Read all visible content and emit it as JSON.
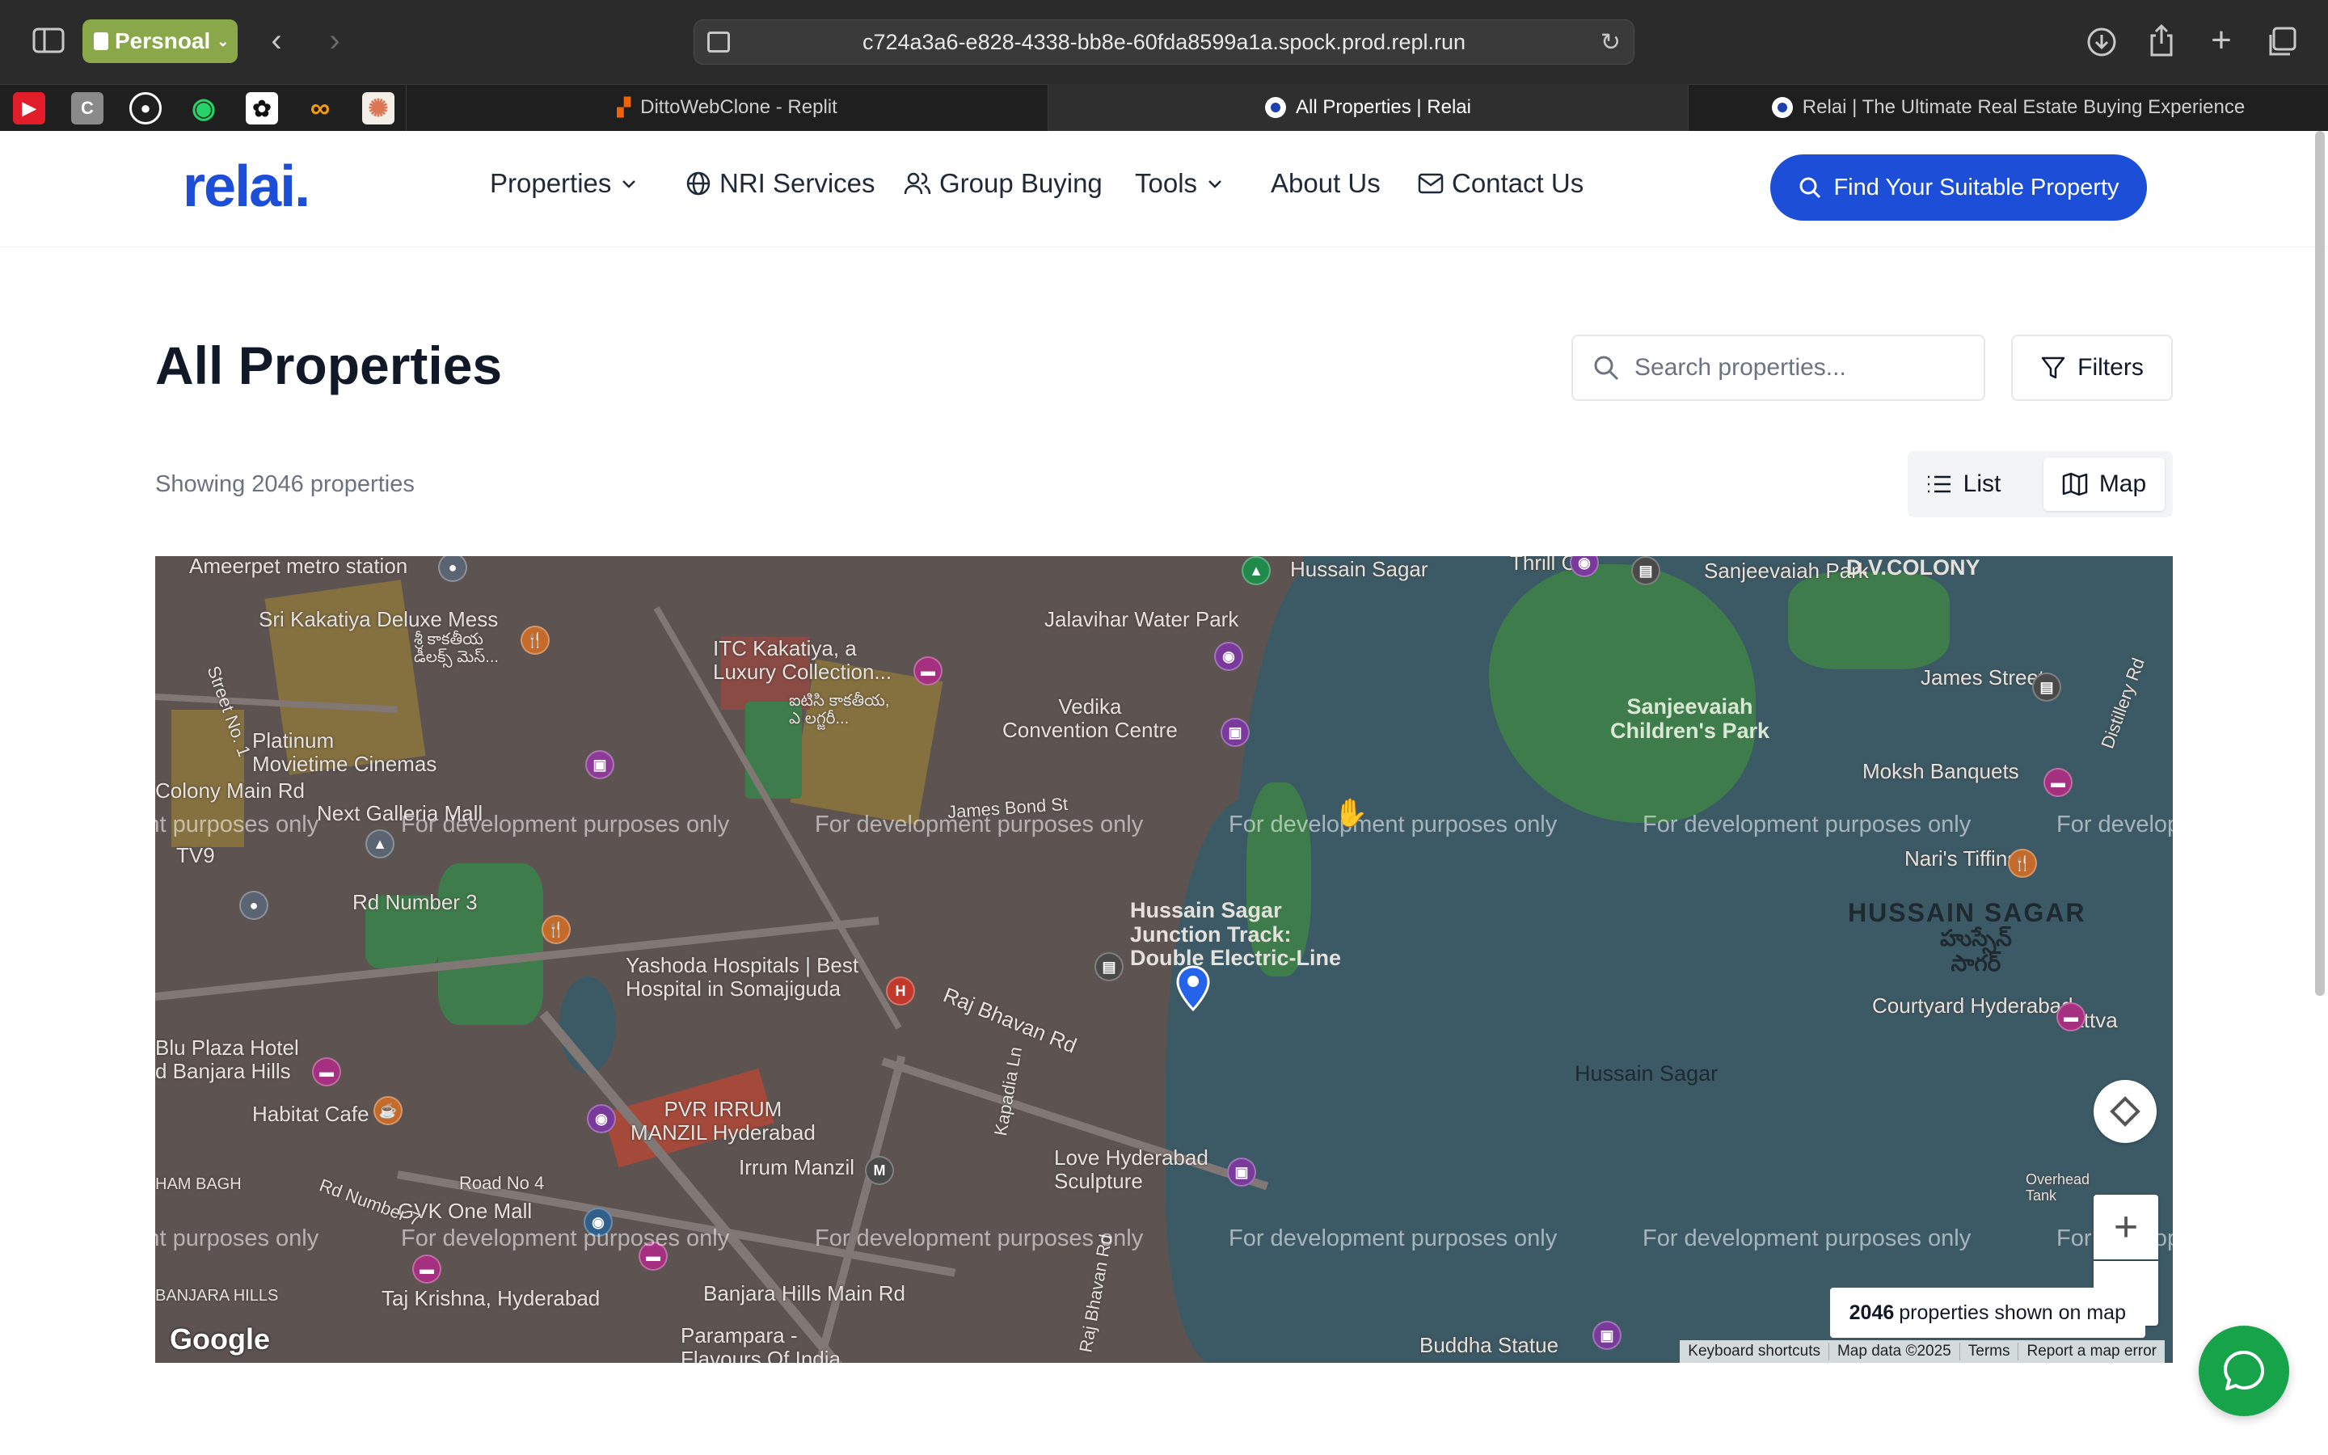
{
  "browser": {
    "profile_label": "Persnoal",
    "url": "c724a3a6-e828-4338-bb8e-60fda8599a1a.spock.prod.repl.run",
    "tabs": [
      {
        "title": "DittoWebClone - Replit"
      },
      {
        "title": "All Properties | Relai"
      },
      {
        "title": "Relai | The Ultimate Real Estate Buying Experience"
      }
    ],
    "bookmarks": [
      "youtube-icon",
      "c-icon",
      "github-icon",
      "whatsapp-icon",
      "openai-icon",
      "infinity-icon",
      "claude-icon"
    ]
  },
  "site": {
    "logo": "relai.",
    "nav": {
      "properties": "Properties",
      "nri": "NRI Services",
      "group": "Group Buying",
      "tools": "Tools",
      "about": "About Us",
      "contact": "Contact Us"
    },
    "cta": "Find Your Suitable Property",
    "accent": "#1d4ed8"
  },
  "page": {
    "title": "All Properties",
    "search_placeholder": "Search properties...",
    "filters_label": "Filters",
    "showing": "Showing 2046 properties",
    "view_list": "List",
    "view_map": "Map"
  },
  "map": {
    "watermark": "For development purposes only",
    "count_number": "2046",
    "count_suffix": "properties shown on map",
    "attribution": [
      "Keyboard shortcuts",
      "Map data ©2025",
      "Terms",
      "Report a map error"
    ],
    "google": "Google",
    "labels": {
      "ameerpet": "Ameerpet metro station",
      "kakatiya_mess": "Sri Kakatiya Deluxe Mess",
      "kakatiya_mess_te": "శ్రీ కాకతీయ\nడీలక్స్ మెస్...",
      "itc": "ITC Kakatiya, a\nLuxury Collection...",
      "itc_te": "ఐటిసి కాకతీయ,\nఎ లగ్జరీ...",
      "jalavihar": "Jalavihar Water Park",
      "hussain_top": "Hussain Sagar",
      "thrill": "Thrill City",
      "sanjeevaiah_park": "Sanjeevaiah Park",
      "dv_colony": "D.V.COLONY",
      "childrens_park": "Sanjeevaiah\nChildren's Park",
      "james_street": "James Street",
      "vedika": "Vedika\nConvention Centre",
      "platinum": "Platinum\nMovietime Cinemas",
      "street_no1": "Street No. 1",
      "colony_main": "Colony Main Rd",
      "galleria": "Next Galleria Mall",
      "james_bond": "James Bond St",
      "moksh": "Moksh Banquets",
      "distillery": "Distillery Rd",
      "tv9": "TV9",
      "rd_no3": "Rd Number 3",
      "naris": "Nari's Tiffins",
      "hussain_sagar_big": "HUSSAIN SAGAR",
      "hussain_sagar_te": "హుస్సేన్\nసాగర్",
      "junction": "Hussain Sagar\nJunction Track:\nDouble Electric-Line",
      "yashoda": "Yashoda Hospitals | Best\nHospital in Somajiguda",
      "raj_bhavan": "Raj Bhavan Rd",
      "courtyard": "Courtyard Hyderabad",
      "blu_plaza": "Blu Plaza Hotel\nd Banjara Hills",
      "habitat": "Habitat Cafe",
      "pvr": "PVR IRRUM\nMANZIL Hyderabad",
      "hussain_sagar_lake": "Hussain Sagar",
      "kapadia": "Kapadia Ln",
      "irrum": "Irrum Manzil",
      "love_hyd": "Love Hyderabad\nSculpture",
      "ham_bagh": "HAM BAGH",
      "road_no4": "Road No 4",
      "gvk": "GVK One Mall",
      "rd_no7": "Rd Number 7",
      "taj_krishna": "Taj Krishna, Hyderabad",
      "banjara_hills": "BANJARA HILLS",
      "banjara_main": "Banjara Hills Main Rd",
      "parampara": "Parampara -\nFlavours Of India",
      "buddha": "Buddha Statue",
      "raj_bhavan2": "Raj Bhavan Rd",
      "sattva": "Sattva",
      "overhead": "Overhead\nTank"
    }
  }
}
